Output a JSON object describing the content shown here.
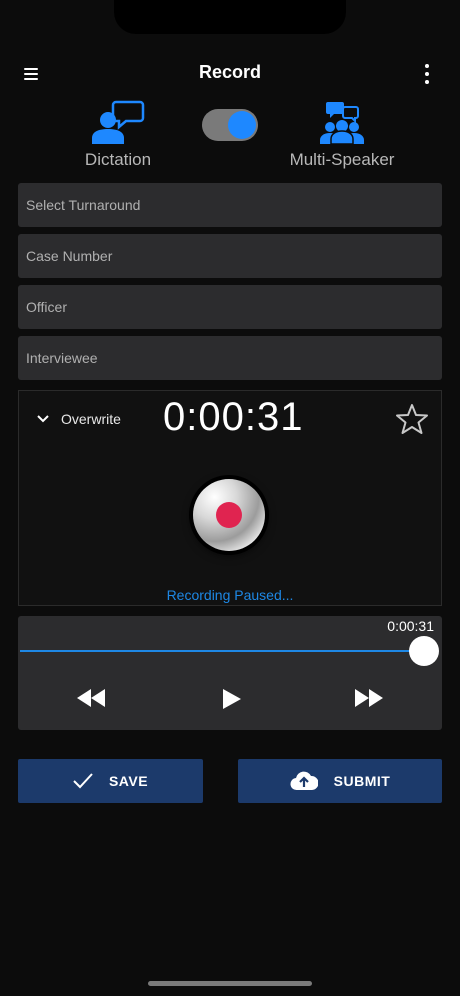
{
  "header": {
    "title": "Record"
  },
  "modes": {
    "dictation": {
      "label": "Dictation"
    },
    "multi_speaker": {
      "label": "Multi-Speaker"
    },
    "toggle_on": true
  },
  "fields": {
    "turnaround": {
      "placeholder": "Select Turnaround"
    },
    "case_number": {
      "placeholder": "Case Number"
    },
    "officer": {
      "placeholder": "Officer"
    },
    "interviewee": {
      "placeholder": "Interviewee"
    }
  },
  "recorder": {
    "mode_label": "Overwrite",
    "timer": "0:00:31",
    "status": "Recording Paused..."
  },
  "player": {
    "elapsed": "0:00:31",
    "progress_percent": 100
  },
  "actions": {
    "save_label": "SAVE",
    "submit_label": "SUBMIT"
  },
  "colors": {
    "accent_blue": "#1e88e5",
    "button_navy": "#1c3a6b",
    "record_red": "#e02450",
    "field_bg": "#2c2c2e"
  },
  "icons": {
    "menu": "hamburger-icon",
    "more": "more-vertical-icon",
    "dictation": "person-speech-icon",
    "multi_speaker": "group-speech-icon",
    "overwrite": "chevron-down-icon",
    "favorite": "star-outline-icon",
    "record": "record-icon",
    "rewind": "rewind-icon",
    "play": "play-icon",
    "forward": "fast-forward-icon",
    "save": "checkmark-icon",
    "submit": "cloud-upload-icon"
  }
}
